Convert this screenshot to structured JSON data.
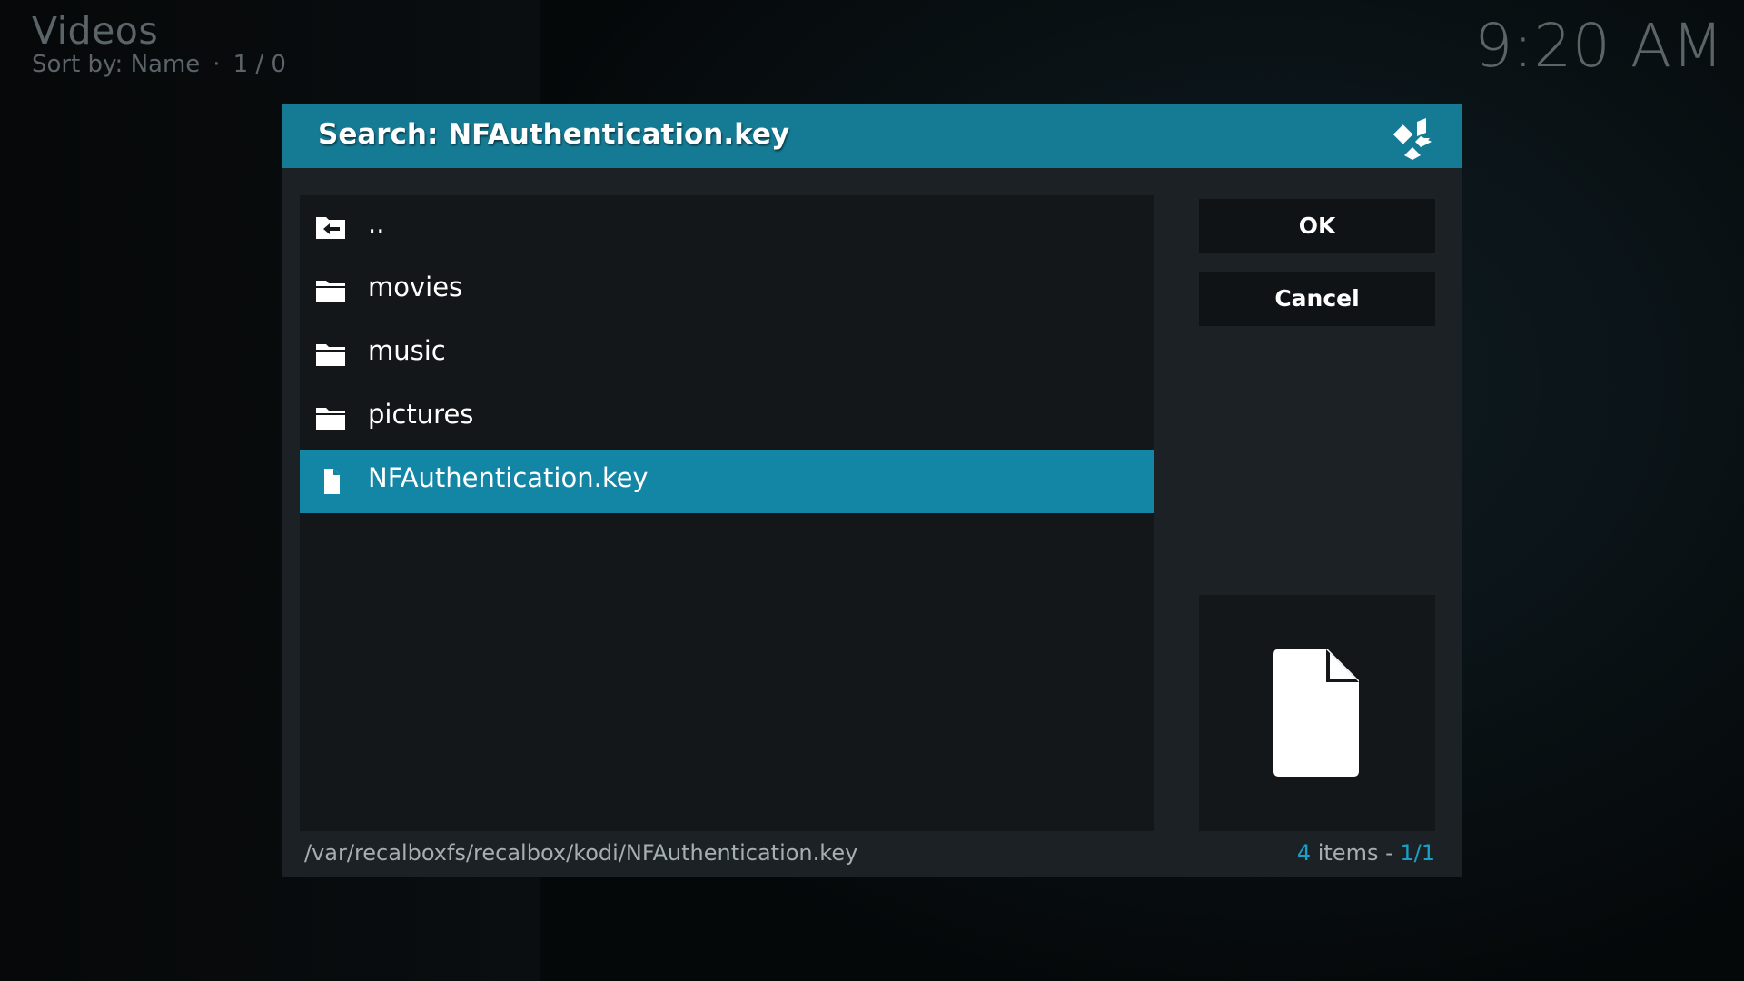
{
  "window": {
    "title": "Videos",
    "sort_label": "Sort by: Name",
    "separator": "·",
    "page_info": "1 / 0",
    "clock": "9:20 AM"
  },
  "dialog": {
    "title": "Search: NFAuthentication.key",
    "logo_icon": "kodi-logo-icon",
    "items": [
      {
        "label": "..",
        "icon": "parent-folder-icon",
        "selected": false
      },
      {
        "label": "movies",
        "icon": "folder-icon",
        "selected": false
      },
      {
        "label": "music",
        "icon": "folder-icon",
        "selected": false
      },
      {
        "label": "pictures",
        "icon": "folder-icon",
        "selected": false
      },
      {
        "label": "NFAuthentication.key",
        "icon": "file-icon",
        "selected": true
      }
    ],
    "buttons": {
      "ok": "OK",
      "cancel": "Cancel"
    },
    "preview_icon": "file-icon",
    "path": "/var/recalboxfs/recalbox/kodi/NFAuthentication.key",
    "count": {
      "items_number": "4",
      "items_text": " items - ",
      "page": "1/1"
    }
  },
  "colors": {
    "accent": "#157b95",
    "selected_row": "#1386a6",
    "highlight_text": "#1aa0c8",
    "dialog_bg": "#1b2125",
    "list_bg": "#131719"
  }
}
